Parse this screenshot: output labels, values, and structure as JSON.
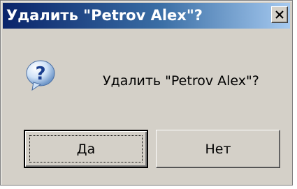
{
  "dialog": {
    "title": "Удалить \"Petrov Alex\"?",
    "message": "Удалить \"Petrov Alex\"?",
    "icon": "question-icon",
    "close_icon": "close-icon",
    "buttons": {
      "yes_label": "Да",
      "no_label": "Нет"
    }
  },
  "colors": {
    "titlebar_start": "#0a246a",
    "titlebar_end": "#a6caf0",
    "dialog_bg": "#d4d0c8"
  }
}
